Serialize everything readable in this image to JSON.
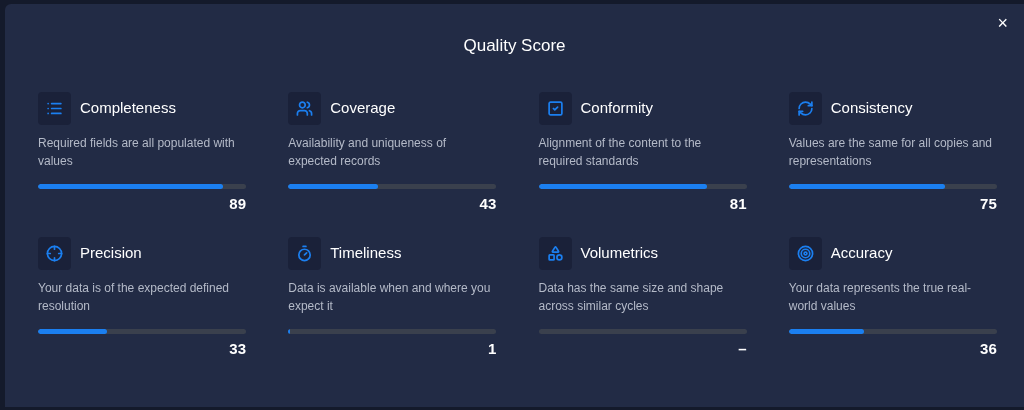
{
  "dialog": {
    "title": "Quality Score",
    "close": "×"
  },
  "metrics": [
    {
      "name": "Completeness",
      "description": "Required fields are all populated with values",
      "level": 0.89,
      "score": "89"
    },
    {
      "name": "Coverage",
      "description": "Availability and uniqueness of expected records",
      "level": 0.43,
      "score": "43"
    },
    {
      "name": "Conformity",
      "description": "Alignment of the content to the required standards",
      "level": 0.81,
      "score": "81"
    },
    {
      "name": "Consistency",
      "description": "Values are the same for all copies and representations",
      "level": 0.75,
      "score": "75"
    },
    {
      "name": "Precision",
      "description": "Your data is of the expected defined resolution",
      "level": 0.33,
      "score": "33"
    },
    {
      "name": "Timeliness",
      "description": "Data is available when and where you expect it",
      "level": 0.01,
      "score": "1"
    },
    {
      "name": "Volumetrics",
      "description": "Data has the same size and shape across similar cycles",
      "level": 0,
      "score": "–"
    },
    {
      "name": "Accuracy",
      "description": "Your data represents the true real-world values",
      "level": 0.36,
      "score": "36"
    }
  ]
}
